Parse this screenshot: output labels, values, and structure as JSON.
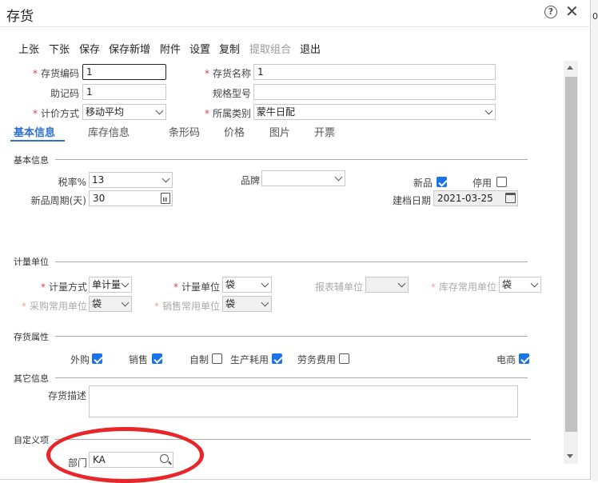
{
  "window": {
    "title": "存货",
    "help_glyph": "?",
    "close_glyph": "✕",
    "bg_text": "0"
  },
  "toolbar": [
    {
      "label": "上张",
      "disabled": false
    },
    {
      "label": "下张",
      "disabled": false
    },
    {
      "label": "保存",
      "disabled": false
    },
    {
      "label": "保存新增",
      "disabled": false
    },
    {
      "label": "附件",
      "disabled": false
    },
    {
      "label": "设置",
      "disabled": false
    },
    {
      "label": "复制",
      "disabled": false
    },
    {
      "label": "提取组合",
      "disabled": true
    },
    {
      "label": "退出",
      "disabled": false
    }
  ],
  "header": {
    "code_label": "存货编码",
    "code_value": "1",
    "name_label": "存货名称",
    "name_value": "1",
    "mnemonic_label": "助记码",
    "mnemonic_value": "1",
    "spec_label": "规格型号",
    "spec_value": "",
    "pricing_label": "计价方式",
    "pricing_value": "移动平均",
    "category_label": "所属类别",
    "category_value": "蒙牛日配"
  },
  "tabs": [
    {
      "label": "基本信息",
      "active": true
    },
    {
      "label": "库存信息",
      "active": false
    },
    {
      "label": "条形码",
      "active": false
    },
    {
      "label": "价格",
      "active": false
    },
    {
      "label": "图片",
      "active": false
    },
    {
      "label": "开票",
      "active": false
    }
  ],
  "basic": {
    "section_title": "基本信息",
    "tax_label": "税率%",
    "tax_value": "13",
    "brand_label": "品牌",
    "brand_value": "",
    "new_label": "新品",
    "new_checked": true,
    "disable_label": "停用",
    "disable_checked": false,
    "cycle_label": "新品周期(天)",
    "cycle_value": "30",
    "created_label": "建档日期",
    "created_value": "2021-03-25"
  },
  "units": {
    "section_title": "计量单位",
    "method_label": "计量方式",
    "method_value": "单计量",
    "unit_label": "计量单位",
    "unit_value": "袋",
    "report_label": "报表辅单位",
    "report_value": "",
    "stock_label": "库存常用单位",
    "stock_value": "袋",
    "purchase_label": "采购常用单位",
    "purchase_value": "袋",
    "sales_label": "销售常用单位",
    "sales_value": "袋"
  },
  "attributes": {
    "section_title": "存货属性",
    "items": [
      {
        "label": "外购",
        "checked": true
      },
      {
        "label": "销售",
        "checked": true
      },
      {
        "label": "自制",
        "checked": false
      },
      {
        "label": "生产耗用",
        "checked": true
      },
      {
        "label": "劳务费用",
        "checked": false
      },
      {
        "label": "电商",
        "checked": true
      }
    ]
  },
  "other": {
    "section_title": "其它信息",
    "desc_label": "存货描述",
    "desc_value": ""
  },
  "custom": {
    "section_title": "自定义项",
    "dept_label": "部门",
    "dept_value": "KA"
  },
  "colors": {
    "accent": "#2f6fd2",
    "checkbox": "#1a73e8",
    "required": "#e14040",
    "highlight_ellipse": "#e8262a"
  }
}
